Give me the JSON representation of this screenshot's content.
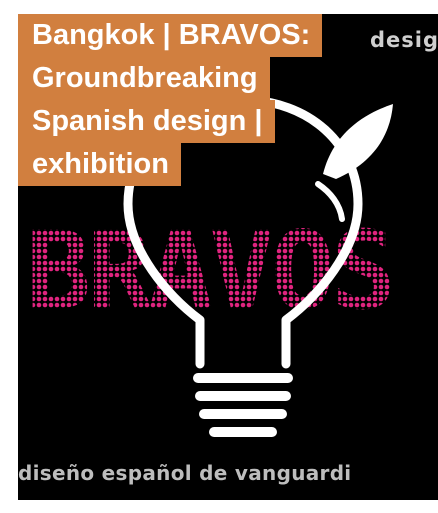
{
  "article": {
    "title_lines": [
      "Bangkok | BRAVOS:",
      "Groundbreaking",
      "Spanish design |",
      "exhibition"
    ]
  },
  "poster": {
    "top_word": "desig",
    "logo_text": "BRAVOS",
    "tagline": "diseño español de vanguardi",
    "logo_icon": "lightbulb-icon",
    "colors": {
      "background": "#000000",
      "caption_bg": "#d17f3f",
      "logo_pink": "#e0247f",
      "bulb_white": "#ffffff"
    }
  }
}
